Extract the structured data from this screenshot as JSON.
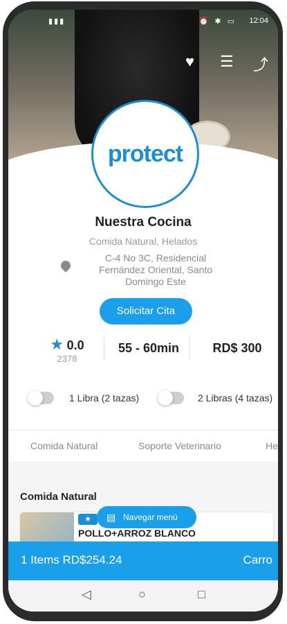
{
  "status": {
    "time": "12:04",
    "signal": "▮▮▮",
    "icons": "⏰ ✱ ▭"
  },
  "hero": {
    "heart": "♥",
    "menu": "☰",
    "share": "⤴"
  },
  "logo": {
    "text": "protect"
  },
  "restaurant": {
    "name": "Nuestra Cocina",
    "categories": "Comida Natural, Helados",
    "address": "C-4 No 3C, Residencial Fernández Oriental, Santo Domingo Este",
    "cta": "Solicitar Cita"
  },
  "stats": {
    "rating": "0.0",
    "rating_count": "2378",
    "delivery_time": "55 - 60min",
    "price": "RD$ 300"
  },
  "options": [
    {
      "label": "1 Libra (2 tazas)",
      "on": false
    },
    {
      "label": "2 Libras (4 tazas)",
      "on": false
    }
  ],
  "tabs": [
    "Comida Natural",
    "Soporte Veterinario",
    "He"
  ],
  "section": {
    "title": "Comida Natural"
  },
  "product": {
    "name": "POLLO+ARROZ BLANCO",
    "badge": "★"
  },
  "nav_menu": {
    "label": "Navegar menú",
    "icon": "▤"
  },
  "cart": {
    "summary": "1 Items RD$254.24",
    "label": "Carro"
  },
  "android_nav": {
    "back": "◁",
    "home": "○",
    "recent": "□"
  },
  "colors": {
    "accent": "#1aa0ea",
    "logo": "#1a8fd8"
  }
}
